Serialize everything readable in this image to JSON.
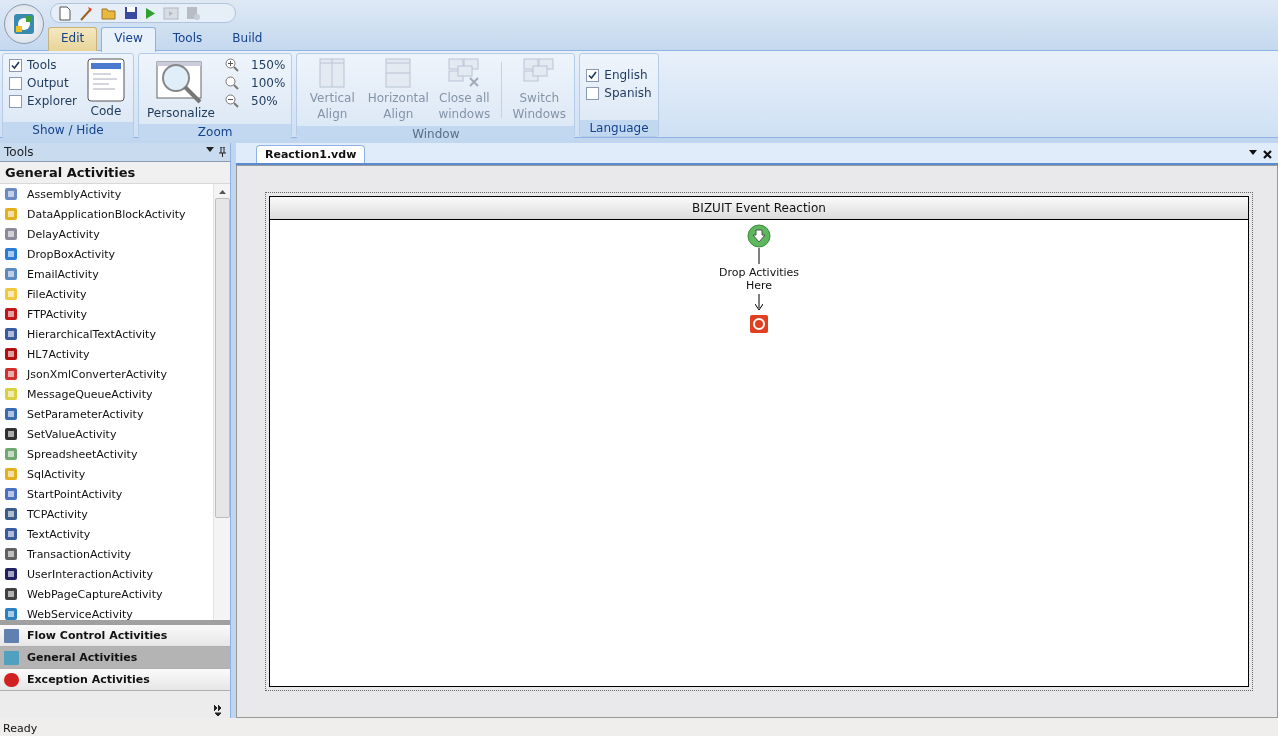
{
  "ribbon_tabs": [
    {
      "label": "Edit",
      "selected": false,
      "highlighted": true
    },
    {
      "label": "View",
      "selected": true,
      "highlighted": false
    },
    {
      "label": "Tools",
      "selected": false,
      "highlighted": false
    },
    {
      "label": "Build",
      "selected": false,
      "highlighted": false
    }
  ],
  "show_hide": {
    "checkboxes": [
      {
        "label": "Tools",
        "checked": true
      },
      {
        "label": "Output",
        "checked": false
      },
      {
        "label": "Explorer",
        "checked": false
      }
    ],
    "code_button": "Code",
    "caption": "Show / Hide"
  },
  "zoom": {
    "personalize_button": "Personalize",
    "levels": [
      "150%",
      "100%",
      "50%"
    ],
    "caption": "Zoom"
  },
  "window": {
    "buttons": [
      {
        "label": "Vertical Align",
        "disabled": true
      },
      {
        "label": "Horizontal Align",
        "disabled": true
      },
      {
        "label": "Close all windows",
        "disabled": true
      },
      {
        "label": "Switch Windows",
        "disabled": true
      }
    ],
    "caption": "Window"
  },
  "language": {
    "checkboxes": [
      {
        "label": "English",
        "checked": true
      },
      {
        "label": "Spanish",
        "checked": false
      }
    ],
    "caption": "Language"
  },
  "tools_panel": {
    "title": "Tools",
    "section": "General Activities",
    "items": [
      "AssemblyActivity",
      "DataApplicationBlockActivity",
      "DelayActivity",
      "DropBoxActivity",
      "EmailActivity",
      "FileActivity",
      "FTPActivity",
      "HierarchicalTextActivity",
      "HL7Activity",
      "JsonXmlConverterActivity",
      "MessageQueueActivity",
      "SetParameterActivity",
      "SetValueActivity",
      "SpreadsheetActivity",
      "SqlActivity",
      "StartPointActivity",
      "TCPActivity",
      "TextActivity",
      "TransactionActivity",
      "UserInteractionActivity",
      "WebPageCaptureActivity",
      "WebServiceActivity"
    ],
    "categories": [
      {
        "label": "Flow Control Activities",
        "selected": false
      },
      {
        "label": "General Activities",
        "selected": true
      },
      {
        "label": "Exception Activities",
        "selected": false
      }
    ]
  },
  "document": {
    "tab": "Reaction1.vdw",
    "workflow_title": "BIZUIT Event Reaction",
    "drop_hint": "Drop Activities Here"
  },
  "status_bar": "Ready"
}
